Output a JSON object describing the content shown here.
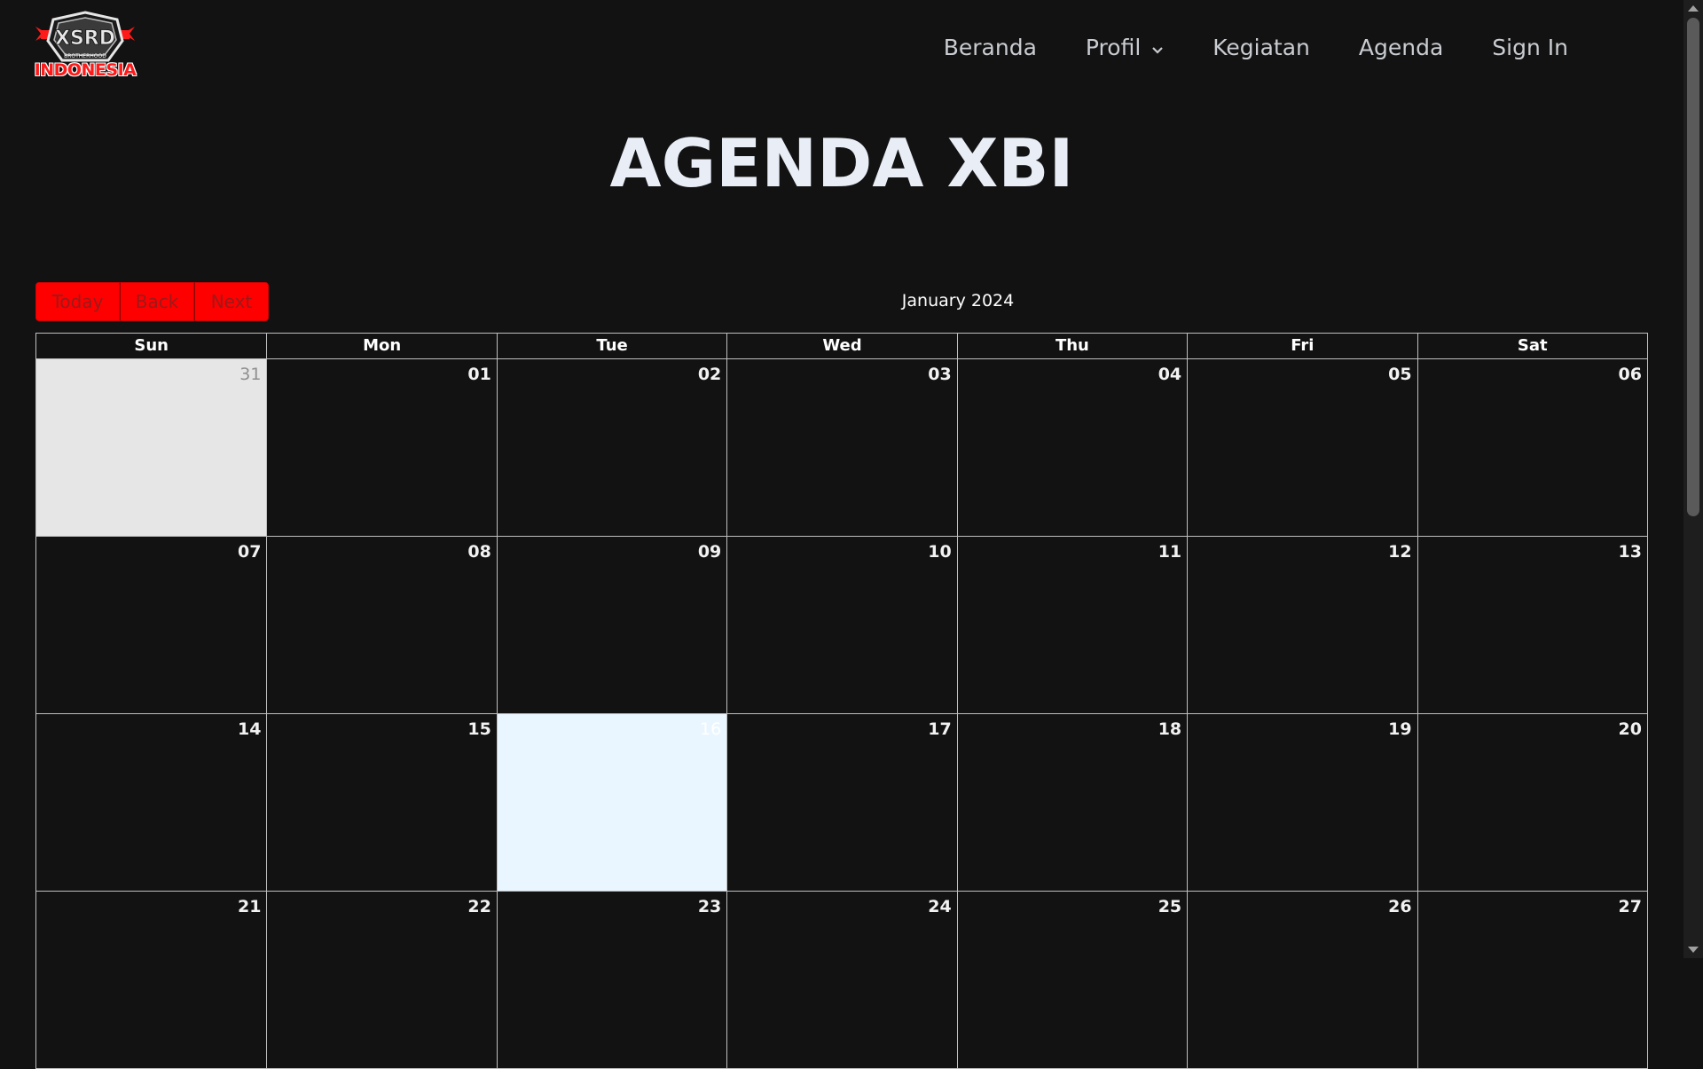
{
  "brand": {
    "logo_name": "XBI logo",
    "logo_text": "INDONESIA",
    "logo_subtext": "BROTHERHOOD",
    "accent": "#ff0000"
  },
  "nav": {
    "items": [
      {
        "label": "Beranda"
      },
      {
        "label": "Profil",
        "has_dropdown": true
      },
      {
        "label": "Kegiatan"
      },
      {
        "label": "Agenda"
      },
      {
        "label": "Sign In"
      }
    ]
  },
  "page": {
    "title": "AGENDA XBI"
  },
  "toolbar": {
    "today_label": "Today",
    "back_label": "Back",
    "next_label": "Next",
    "month_label": "January 2024"
  },
  "calendar": {
    "weekdays": [
      "Sun",
      "Mon",
      "Tue",
      "Wed",
      "Thu",
      "Fri",
      "Sat"
    ],
    "weeks": [
      [
        {
          "n": "31",
          "off": true
        },
        {
          "n": "01"
        },
        {
          "n": "02"
        },
        {
          "n": "03"
        },
        {
          "n": "04"
        },
        {
          "n": "05"
        },
        {
          "n": "06"
        }
      ],
      [
        {
          "n": "07"
        },
        {
          "n": "08"
        },
        {
          "n": "09"
        },
        {
          "n": "10"
        },
        {
          "n": "11"
        },
        {
          "n": "12"
        },
        {
          "n": "13"
        }
      ],
      [
        {
          "n": "14"
        },
        {
          "n": "15"
        },
        {
          "n": "16",
          "today": true
        },
        {
          "n": "17"
        },
        {
          "n": "18"
        },
        {
          "n": "19"
        },
        {
          "n": "20"
        }
      ],
      [
        {
          "n": "21"
        },
        {
          "n": "22"
        },
        {
          "n": "23"
        },
        {
          "n": "24"
        },
        {
          "n": "25"
        },
        {
          "n": "26"
        },
        {
          "n": "27"
        }
      ]
    ]
  }
}
